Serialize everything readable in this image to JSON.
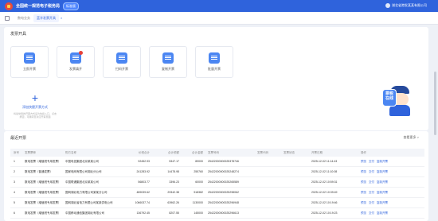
{
  "header": {
    "title": "全国统一规范电子税务局",
    "badge": "标准版",
    "user": "湖北省港发某某有限公司"
  },
  "tabs": {
    "tab1": "数电业务",
    "active": "蓝字发票开具",
    "close": "×"
  },
  "shortcuts": {
    "title": "发票开具",
    "items": [
      {
        "label": "立即开票",
        "icon": "invoice-icon"
      },
      {
        "label": "发票填开",
        "icon": "edit-invoice-icon"
      },
      {
        "label": "扫码开票",
        "icon": "qr-code-icon"
      },
      {
        "label": "复制开票",
        "icon": "copy-invoice-icon"
      },
      {
        "label": "批量开票",
        "icon": "batch-invoice-icon"
      }
    ],
    "add_label": "添加快捷开票方式",
    "add_hint": "将最常用的开票方式设为快捷入口，点击按钮，可跳转至对应开票页面"
  },
  "mascot": {
    "text": "票税 在线"
  },
  "recent": {
    "title": "最近开票",
    "more": "查看更多 >",
    "columns": [
      "序号",
      "发票票种",
      "购方名称",
      "价税合计",
      "合计税额",
      "合计金额",
      "发票号码",
      "发票代码",
      "发票状态",
      "开票日期",
      "操作"
    ],
    "rows": [
      [
        "1",
        "数电发票（增值税专用发票）",
        "中国电信集团北京某某公司",
        "92452.93",
        "5347.17",
        "89000",
        "25422000000025378746",
        "",
        "",
        "2025-12-02 11:14:43"
      ],
      [
        "2",
        "数电发票（普通发票）",
        "国家电网有限公司湖北分公司",
        "241283.92",
        "14478.98",
        "255760",
        "25422000000025248274",
        "",
        "",
        "2025-12-02 11:10:08"
      ],
      [
        "3",
        "数电发票（增值税专用发票）",
        "中国联通集团北京某某公司",
        "56803.77",
        "3396.23",
        "60000",
        "25422000000025265589",
        "",
        "",
        "2025-12-02 10:59:31"
      ],
      [
        "4",
        "数电发票（增值税专用发票）",
        "国网湖北电力有限公司某某分公司",
        "489039.62",
        "29342.38",
        "518382",
        "25422000000025298062",
        "",
        "",
        "2025-12-02 10:39:49"
      ],
      [
        "5",
        "数电发票（增值税专用发票）",
        "国网湖北省电力有限公司某某供电公司",
        "1066037.74",
        "63962.26",
        "1130000",
        "25422000000025296948",
        "",
        "",
        "2025-12-02 10:19:46"
      ],
      [
        "6",
        "数电发票（增值税专用发票）",
        "中国移动通信集团湖北有限公司",
        "136792.45",
        "8207.55",
        "145000",
        "25422000000025296613",
        "",
        "",
        "2025-12-02 10:19:23"
      ]
    ],
    "ops": [
      "预览",
      "交付",
      "复制开票"
    ]
  }
}
